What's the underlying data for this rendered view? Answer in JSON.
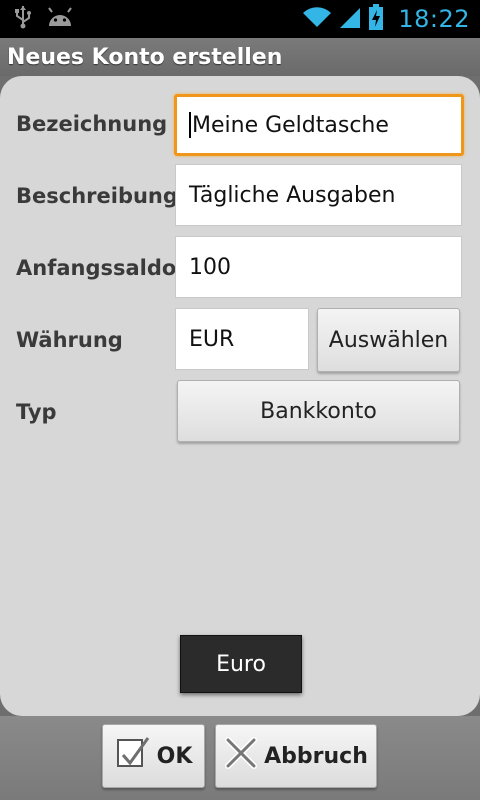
{
  "status_bar": {
    "time": "18:22",
    "icons": [
      "usb-icon",
      "android-icon",
      "wifi-icon",
      "signal-icon",
      "battery-charging-icon"
    ],
    "accent_color": "#33b5e5"
  },
  "title": "Neues Konto erstellen",
  "form": {
    "name_label": "Bezeichnung",
    "name_value": "Meine Geldtasche",
    "description_label": "Beschreibung",
    "description_value": "Tägliche Ausgaben",
    "balance_label": "Anfangssaldo",
    "balance_value": "100",
    "currency_label": "Währung",
    "currency_value": "EUR",
    "currency_select_label": "Auswählen",
    "type_label": "Typ",
    "type_value": "Bankkonto"
  },
  "toast": "Euro",
  "actions": {
    "ok_label": "OK",
    "cancel_label": "Abbruch"
  },
  "focus_color": "#f0961a"
}
